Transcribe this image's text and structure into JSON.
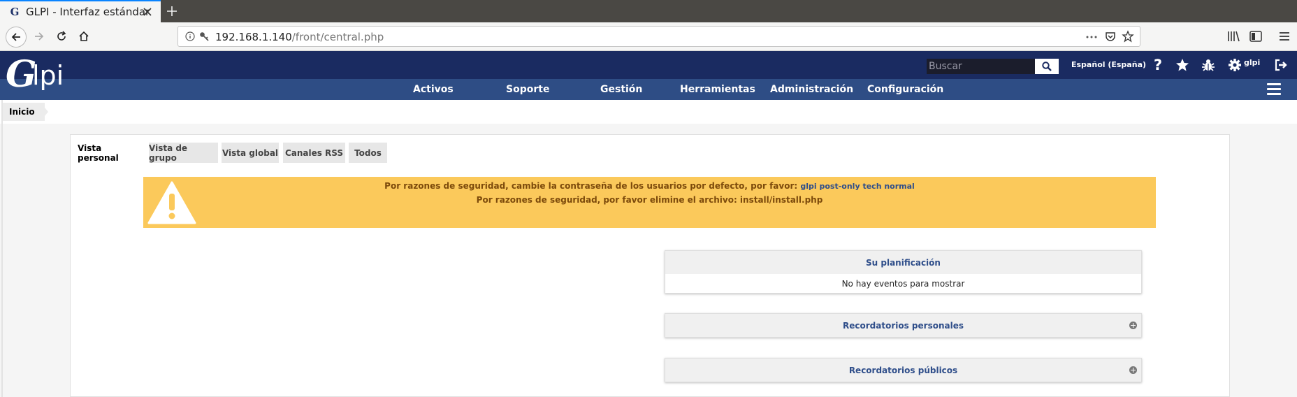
{
  "browser": {
    "tab_title": "GLPI - Interfaz estándar",
    "tab_favicon": "G",
    "url_host": "192.168.1.140",
    "url_path": "/front/central.php",
    "icons": [
      "back-icon",
      "forward-icon",
      "reload-icon",
      "home-icon",
      "info-icon",
      "key-icon",
      "more-icon",
      "pocket-icon",
      "bookmark-star-icon",
      "library-icon",
      "sidebar-icon",
      "menu-icon"
    ]
  },
  "header": {
    "logo_g": "G",
    "logo_text": "lpi",
    "search_placeholder": "Buscar",
    "language": "Español (España)",
    "user": "glpi",
    "icons": [
      "help-icon",
      "favorites-star-icon",
      "debug-bug-icon",
      "gear-icon",
      "logout-icon"
    ]
  },
  "menu": {
    "items": [
      "Activos",
      "Soporte",
      "Gestión",
      "Herramientas",
      "Administración",
      "Configuración"
    ]
  },
  "breadcrumb": {
    "home": "Inicio"
  },
  "tabs": [
    {
      "label": "Vista personal",
      "active": true
    },
    {
      "label": "Vista de grupo",
      "active": false
    },
    {
      "label": "Vista global",
      "active": false
    },
    {
      "label": "Canales RSS",
      "active": false
    },
    {
      "label": "Todos",
      "active": false
    }
  ],
  "warning": {
    "line1": "Por razones de seguridad, cambie la contraseña de los usuarios por defecto, por favor:",
    "line1_link": "glpi post-only tech normal",
    "line2": "Por razones de seguridad, por favor elimine el archivo: install/install.php",
    "color": "#fbc95b"
  },
  "widgets": {
    "planning_title": "Su planificación",
    "planning_empty": "No hay eventos para mostrar",
    "personal_reminders": "Recordatorios personales",
    "public_reminders": "Recordatorios públicos"
  },
  "colors": {
    "header_dark": "#1a2b61",
    "menu_bar": "#2e4d85",
    "link": "#2f4e8a"
  }
}
